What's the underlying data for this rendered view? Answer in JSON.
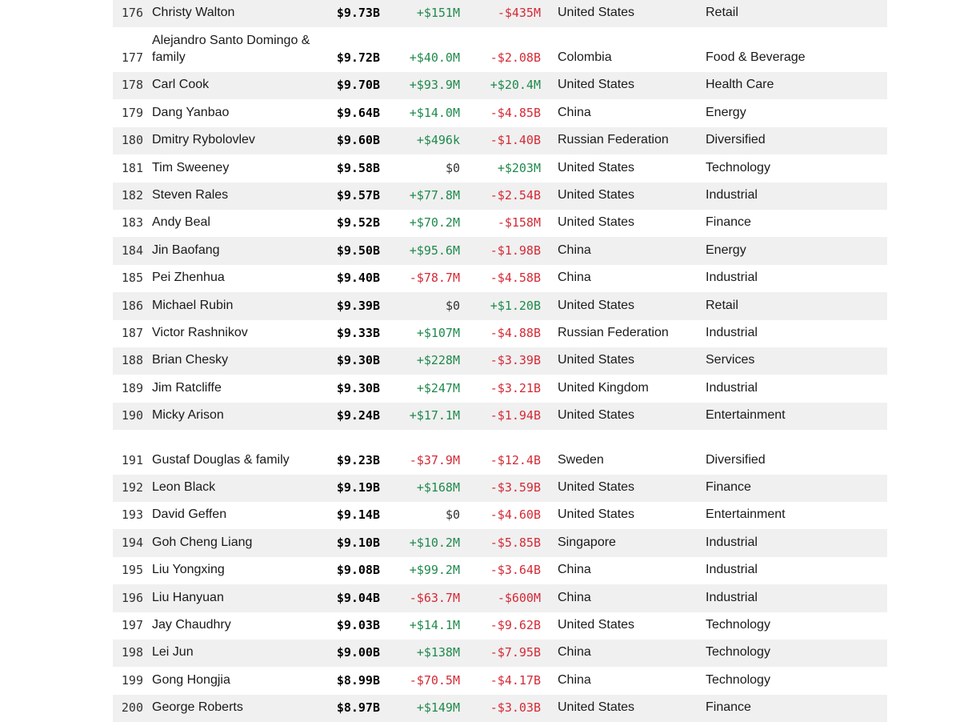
{
  "colors": {
    "positive": "#1f8a4c",
    "negative": "#d42a36",
    "neutral": "#333333",
    "row_shade": "#f0f0f0"
  },
  "rows": [
    {
      "rank": "176",
      "name": "Christy Walton",
      "net_worth": "$9.73B",
      "last_change": "+$151M",
      "ytd_change": "-$435M",
      "country": "United States",
      "industry": "Retail"
    },
    {
      "rank": "177",
      "name": "Alejandro Santo Domingo & family",
      "net_worth": "$9.72B",
      "last_change": "+$40.0M",
      "ytd_change": "-$2.08B",
      "country": "Colombia",
      "industry": "Food & Beverage"
    },
    {
      "rank": "178",
      "name": "Carl Cook",
      "net_worth": "$9.70B",
      "last_change": "+$93.9M",
      "ytd_change": "+$20.4M",
      "country": "United States",
      "industry": "Health Care"
    },
    {
      "rank": "179",
      "name": "Dang Yanbao",
      "net_worth": "$9.64B",
      "last_change": "+$14.0M",
      "ytd_change": "-$4.85B",
      "country": "China",
      "industry": "Energy"
    },
    {
      "rank": "180",
      "name": "Dmitry Rybolovlev",
      "net_worth": "$9.60B",
      "last_change": "+$496k",
      "ytd_change": "-$1.40B",
      "country": "Russian Federation",
      "industry": "Diversified"
    },
    {
      "rank": "181",
      "name": "Tim Sweeney",
      "net_worth": "$9.58B",
      "last_change": "$0",
      "ytd_change": "+$203M",
      "country": "United States",
      "industry": "Technology"
    },
    {
      "rank": "182",
      "name": "Steven Rales",
      "net_worth": "$9.57B",
      "last_change": "+$77.8M",
      "ytd_change": "-$2.54B",
      "country": "United States",
      "industry": "Industrial"
    },
    {
      "rank": "183",
      "name": "Andy Beal",
      "net_worth": "$9.52B",
      "last_change": "+$70.2M",
      "ytd_change": "-$158M",
      "country": "United States",
      "industry": "Finance"
    },
    {
      "rank": "184",
      "name": "Jin Baofang",
      "net_worth": "$9.50B",
      "last_change": "+$95.6M",
      "ytd_change": "-$1.98B",
      "country": "China",
      "industry": "Energy"
    },
    {
      "rank": "185",
      "name": "Pei Zhenhua",
      "net_worth": "$9.40B",
      "last_change": "-$78.7M",
      "ytd_change": "-$4.58B",
      "country": "China",
      "industry": "Industrial"
    },
    {
      "rank": "186",
      "name": "Michael Rubin",
      "net_worth": "$9.39B",
      "last_change": "$0",
      "ytd_change": "+$1.20B",
      "country": "United States",
      "industry": "Retail"
    },
    {
      "rank": "187",
      "name": "Victor Rashnikov",
      "net_worth": "$9.33B",
      "last_change": "+$107M",
      "ytd_change": "-$4.88B",
      "country": "Russian Federation",
      "industry": "Industrial"
    },
    {
      "rank": "188",
      "name": "Brian Chesky",
      "net_worth": "$9.30B",
      "last_change": "+$228M",
      "ytd_change": "-$3.39B",
      "country": "United States",
      "industry": "Services"
    },
    {
      "rank": "189",
      "name": "Jim Ratcliffe",
      "net_worth": "$9.30B",
      "last_change": "+$247M",
      "ytd_change": "-$3.21B",
      "country": "United Kingdom",
      "industry": "Industrial"
    },
    {
      "rank": "190",
      "name": "Micky Arison",
      "net_worth": "$9.24B",
      "last_change": "+$17.1M",
      "ytd_change": "-$1.94B",
      "country": "United States",
      "industry": "Entertainment"
    },
    {
      "rank": "191",
      "name": "Gustaf Douglas & family",
      "net_worth": "$9.23B",
      "last_change": "-$37.9M",
      "ytd_change": "-$12.4B",
      "country": "Sweden",
      "industry": "Diversified"
    },
    {
      "rank": "192",
      "name": "Leon Black",
      "net_worth": "$9.19B",
      "last_change": "+$168M",
      "ytd_change": "-$3.59B",
      "country": "United States",
      "industry": "Finance"
    },
    {
      "rank": "193",
      "name": "David Geffen",
      "net_worth": "$9.14B",
      "last_change": "$0",
      "ytd_change": "-$4.60B",
      "country": "United States",
      "industry": "Entertainment"
    },
    {
      "rank": "194",
      "name": "Goh Cheng Liang",
      "net_worth": "$9.10B",
      "last_change": "+$10.2M",
      "ytd_change": "-$5.85B",
      "country": "Singapore",
      "industry": "Industrial"
    },
    {
      "rank": "195",
      "name": "Liu Yongxing",
      "net_worth": "$9.08B",
      "last_change": "+$99.2M",
      "ytd_change": "-$3.64B",
      "country": "China",
      "industry": "Industrial"
    },
    {
      "rank": "196",
      "name": "Liu Hanyuan",
      "net_worth": "$9.04B",
      "last_change": "-$63.7M",
      "ytd_change": "-$600M",
      "country": "China",
      "industry": "Industrial"
    },
    {
      "rank": "197",
      "name": "Jay Chaudhry",
      "net_worth": "$9.03B",
      "last_change": "+$14.1M",
      "ytd_change": "-$9.62B",
      "country": "United States",
      "industry": "Technology"
    },
    {
      "rank": "198",
      "name": "Lei Jun",
      "net_worth": "$9.00B",
      "last_change": "+$138M",
      "ytd_change": "-$7.95B",
      "country": "China",
      "industry": "Technology"
    },
    {
      "rank": "199",
      "name": "Gong Hongjia",
      "net_worth": "$8.99B",
      "last_change": "-$70.5M",
      "ytd_change": "-$4.17B",
      "country": "China",
      "industry": "Technology"
    },
    {
      "rank": "200",
      "name": "George Roberts",
      "net_worth": "$8.97B",
      "last_change": "+$149M",
      "ytd_change": "-$3.03B",
      "country": "United States",
      "industry": "Finance"
    }
  ]
}
